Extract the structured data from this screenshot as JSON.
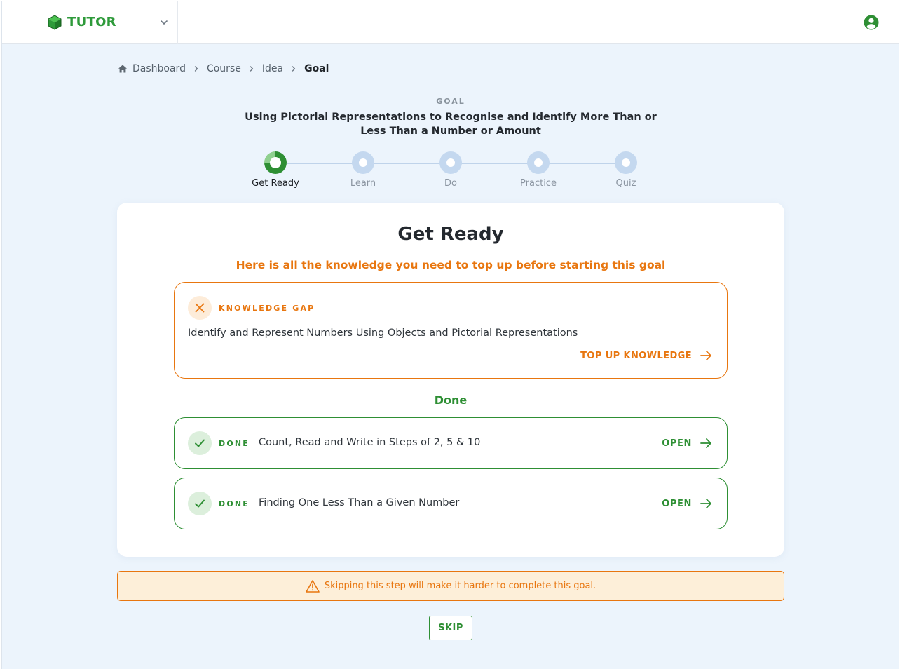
{
  "app": {
    "brand": "TUTOR"
  },
  "breadcrumb": {
    "items": [
      "Dashboard",
      "Course",
      "Idea"
    ],
    "current": "Goal"
  },
  "goal": {
    "kicker": "GOAL",
    "title": "Using Pictorial Representations to Recognise and Identify More Than or Less Than a Number or Amount"
  },
  "stepper": {
    "steps": [
      "Get Ready",
      "Learn",
      "Do",
      "Practice",
      "Quiz"
    ],
    "active_index": 0,
    "active_progress": 0.75
  },
  "card": {
    "title": "Get Ready",
    "subtitle": "Here is all the knowledge you need to top up before starting this goal",
    "gap": {
      "tag": "KNOWLEDGE GAP",
      "text": "Identify and Represent Numbers Using Objects and Pictorial Representations",
      "action": "TOP UP KNOWLEDGE"
    },
    "done_heading": "Done",
    "done_items": [
      {
        "tag": "DONE",
        "text": "Count, Read and Write in Steps of 2, 5 & 10",
        "action": "OPEN"
      },
      {
        "tag": "DONE",
        "text": "Finding One Less Than a Given Number",
        "action": "OPEN"
      }
    ]
  },
  "warning": {
    "text": "Skipping this step will make it harder to complete this goal."
  },
  "skip_label": "SKIP",
  "colors": {
    "brand_green": "#2e8f34",
    "accent_orange": "#e8760f",
    "background": "#ecf4fc"
  }
}
